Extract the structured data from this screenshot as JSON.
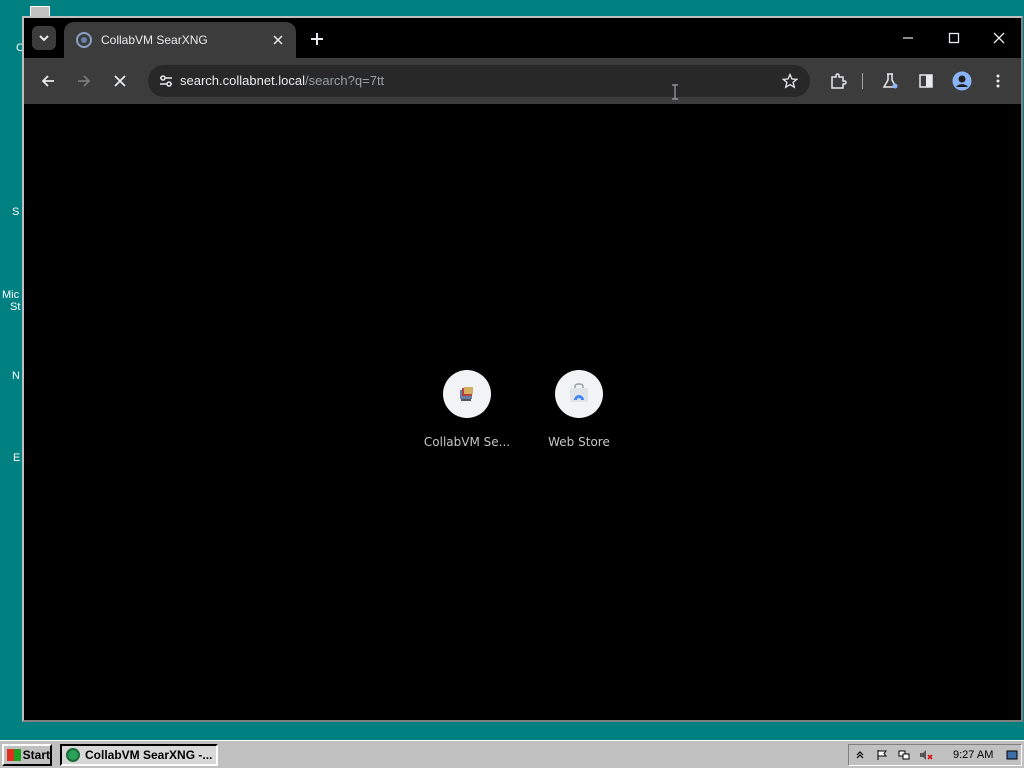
{
  "desktop": {
    "labels": [
      "C",
      "S",
      "Mic",
      "St",
      "N",
      "E"
    ]
  },
  "browser": {
    "tab": {
      "title": "CollabVM SearXNG"
    },
    "omnibox": {
      "host": "search.collabnet.local",
      "path": "/search?q=7tt"
    },
    "shortcuts": [
      {
        "label": "CollabVM Se...",
        "icon": "collabvm-icon"
      },
      {
        "label": "Web Store",
        "icon": "web-store-icon"
      }
    ],
    "colors": {
      "toolbar": "#3c3c3c",
      "tabstrip": "#000000",
      "content": "#000000"
    }
  },
  "taskbar": {
    "start_label": "Start",
    "task_label": "CollabVM SearXNG -...",
    "clock": "9:27 AM"
  }
}
